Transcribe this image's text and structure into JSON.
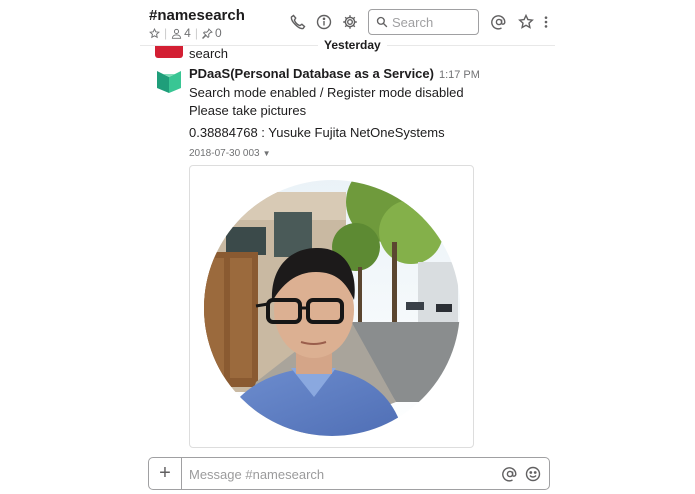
{
  "header": {
    "channel_name": "#namesearch",
    "member_count": "4",
    "pinned_count": "0",
    "search_placeholder": "Search"
  },
  "day_divider": {
    "label": "Yesterday"
  },
  "previous_message": {
    "text": "search"
  },
  "message": {
    "sender": "PDaaS(Personal Database as a Service)",
    "time": "1:17 PM",
    "lines": [
      "Search mode enabled / Register mode disabled",
      "Please take pictures",
      "0.38884768 : Yusuke Fujita NetOneSystems"
    ],
    "file_name": "2018-07-30 003"
  },
  "composer": {
    "placeholder": "Message #namesearch"
  },
  "colors": {
    "accent_red": "#d31f33",
    "bot_avatar_green": "#2eb886",
    "text": "#1d1c1d",
    "muted": "#717274"
  },
  "icons": [
    "star-icon",
    "member-icon",
    "pin-icon",
    "phone-icon",
    "info-icon",
    "gear-icon",
    "search-icon",
    "at-icon",
    "star-outline-icon",
    "more-vertical-icon",
    "plus-icon",
    "emoji-icon"
  ]
}
